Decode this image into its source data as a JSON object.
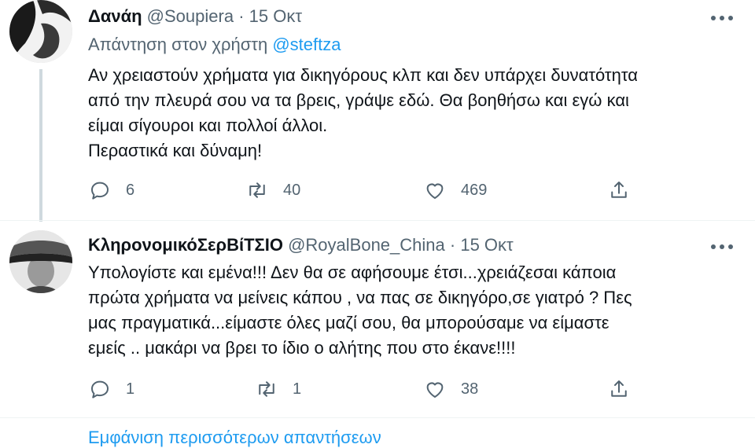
{
  "tweets": [
    {
      "name": "Δανάη",
      "handle": "@Soupiera",
      "separator": "·",
      "date": "15 Οκτ",
      "more_icon": "more-icon",
      "replying_prefix": "Απάντηση στον χρήστη",
      "replying_to": "@steftza",
      "lines": [
        "Αν χρειαστούν χρήματα για δικηγόρους κλπ και δεν υπάρχει δυνατότητα",
        "από την πλευρά σου να τα βρεις, γράψε εδώ. Θα βοηθήσω και εγώ και",
        "είμαι σίγουροι και πολλοί άλλοι.",
        "Περαστικά και δύναμη!"
      ],
      "replies": "6",
      "retweets": "40",
      "likes": "469"
    },
    {
      "name": "ΚληρονομικόΣερΒίΤΣΙΟ",
      "handle": "@RoyalBone_China",
      "separator": "·",
      "date": "15 Οκτ",
      "more_icon": "more-icon",
      "lines": [
        "Υπολογίστε και εμένα!!! Δεν θα σε αφήσουμε έτσι...χρειάζεσαι κάποια",
        "πρώτα χρήματα να μείνεις κάπου , να πας σε δικηγόρο,σε γιατρό ? Πες",
        "μας πραγματικά...είμαστε όλες μαζί σου, θα μπορούσαμε να είμαστε",
        "εμείς .. μακάρι να βρει το ίδιο ο αλήτης που στο έκανε!!!!"
      ],
      "replies": "1",
      "retweets": "1",
      "likes": "38"
    }
  ],
  "show_more": "Εμφάνιση περισσότερων απαντήσεων",
  "colors": {
    "accent": "#1d9bf0",
    "secondary": "#536471",
    "text": "#0f1419"
  }
}
